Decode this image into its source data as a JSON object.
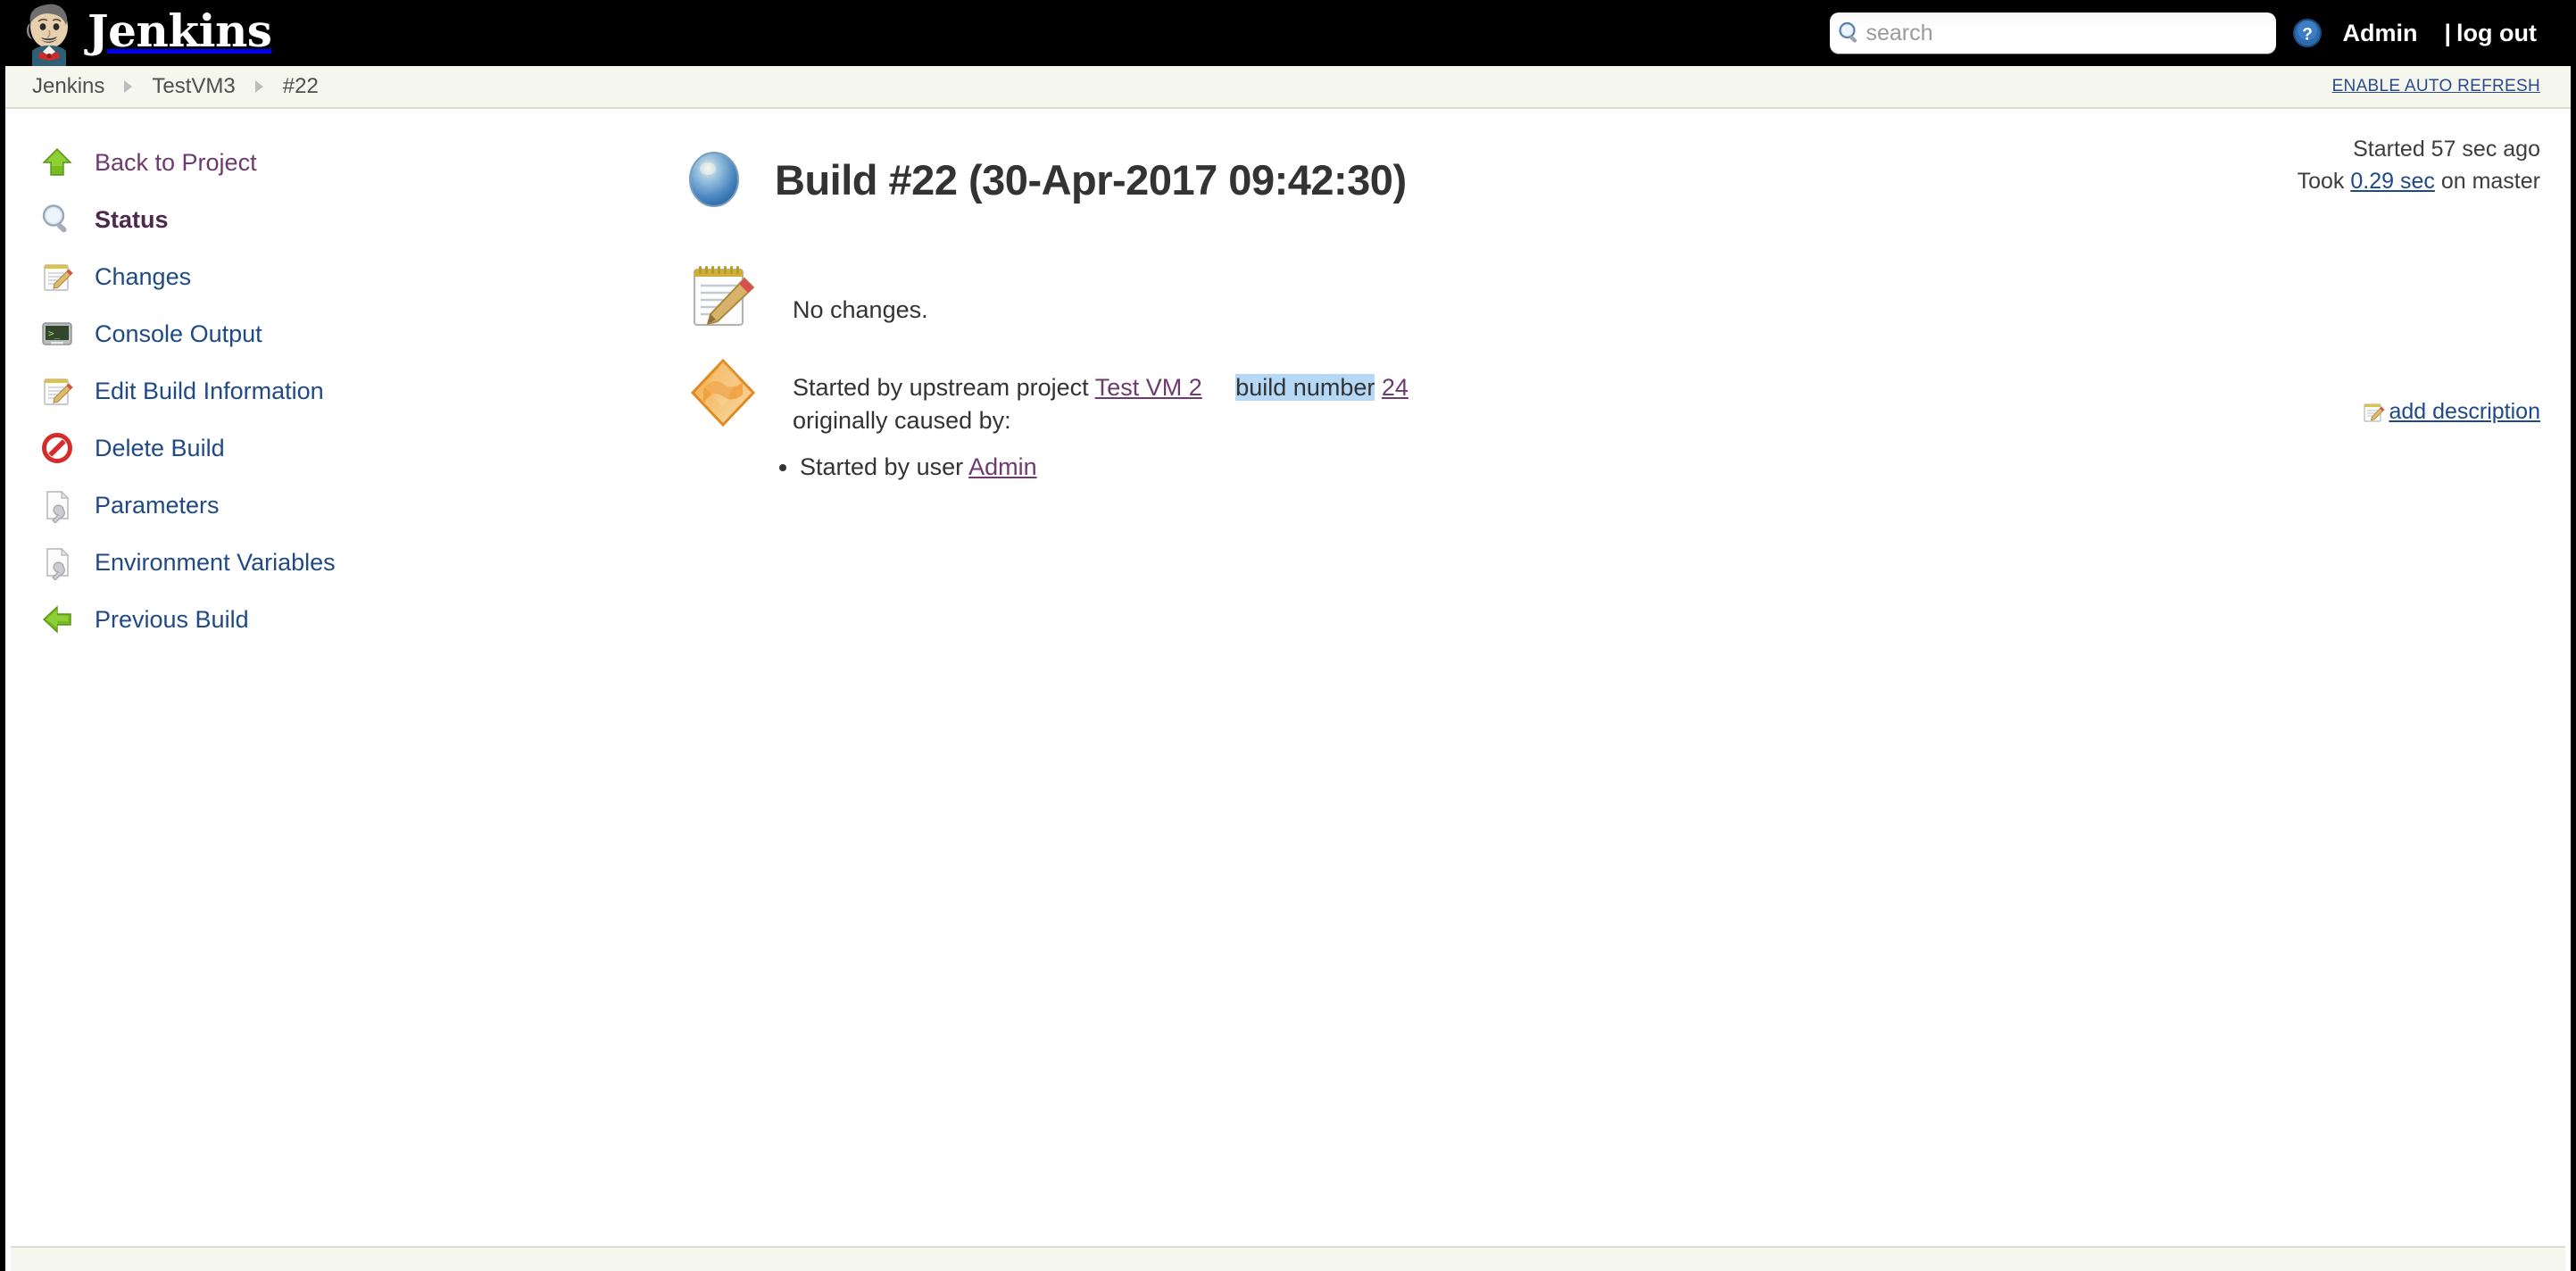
{
  "header": {
    "brand": "Jenkins",
    "brand_icon": "jenkins-butler-logo",
    "search": {
      "value": "",
      "placeholder": "search",
      "icon": "search-icon"
    },
    "help_icon": "help-question-icon",
    "user": "Admin",
    "logout_separator": "|",
    "logout": "log out"
  },
  "breadcrumb": {
    "items": [
      {
        "label": "Jenkins"
      },
      {
        "label": "TestVM3"
      },
      {
        "label": "#22"
      }
    ],
    "auto_refresh": "ENABLE AUTO REFRESH"
  },
  "sidebar": {
    "items": [
      {
        "label": "Back to Project",
        "icon": "green-up-arrow-icon",
        "state": "visited"
      },
      {
        "label": "Status",
        "icon": "magnifier-icon",
        "state": "active"
      },
      {
        "label": "Changes",
        "icon": "notepad-pencil-icon",
        "state": "link"
      },
      {
        "label": "Console Output",
        "icon": "terminal-icon",
        "state": "link"
      },
      {
        "label": "Edit Build Information",
        "icon": "notepad-pencil-icon",
        "state": "link"
      },
      {
        "label": "Delete Build",
        "icon": "no-entry-icon",
        "state": "link"
      },
      {
        "label": "Parameters",
        "icon": "document-wrench-icon",
        "state": "link"
      },
      {
        "label": "Environment Variables",
        "icon": "document-wrench-icon",
        "state": "link"
      },
      {
        "label": "Previous Build",
        "icon": "green-left-arrow-icon",
        "state": "link"
      }
    ]
  },
  "build": {
    "status_icon": "blue-ball-icon",
    "title": "Build #22 (30-Apr-2017 09:42:30)",
    "started_ago": "Started 57 sec ago",
    "took_prefix": "Took",
    "took_duration": "0.29 sec",
    "took_suffix": "on master",
    "add_description": "add description",
    "add_description_icon": "notepad-pencil-icon"
  },
  "changes": {
    "icon": "notepad-pencil-icon",
    "text": "No changes."
  },
  "cause": {
    "icon": "orange-diamond-icon",
    "prefix": "Started by upstream project",
    "project_link": "Test VM 2",
    "build_number_label": "build number",
    "build_number_link": "24",
    "originally_caused_by": "originally caused by:",
    "sub_causes": [
      {
        "prefix": "Started by user",
        "user_link": "Admin"
      }
    ]
  },
  "colors": {
    "top_bar": "#000000",
    "breadcrumb_bg": "#f5f7ef",
    "link_blue": "#204a87",
    "link_visited_purple": "#6d3b6d",
    "selection_highlight": "#b4d8f5",
    "accent_green": "#7db72f",
    "accent_orange": "#ef9a34"
  }
}
